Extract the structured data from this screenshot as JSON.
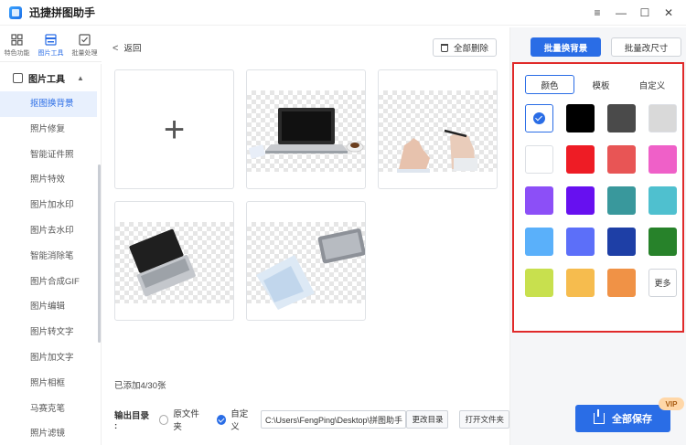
{
  "app": {
    "title": "迅捷拼图助手"
  },
  "window_controls": {
    "menu": "≡",
    "minimize": "—",
    "maximize": "☐",
    "close": "✕"
  },
  "top_icons": [
    {
      "label": "特色功能",
      "icon": "grid-icon"
    },
    {
      "label": "图片工具",
      "icon": "image-tool-icon",
      "active": true
    },
    {
      "label": "批量处理",
      "icon": "batch-icon"
    }
  ],
  "sidebar": {
    "header": "图片工具",
    "items": [
      "抠图换背景",
      "照片修复",
      "智能证件照",
      "照片特效",
      "图片加水印",
      "图片去水印",
      "智能消除笔",
      "图片合成GIF",
      "图片编辑",
      "图片转文字",
      "图片加文字",
      "照片相框",
      "马赛克笔",
      "照片滤镜"
    ],
    "active_index": 0
  },
  "main": {
    "back_label": "返回",
    "delete_all_label": "全部删除",
    "count_text": "已添加4/30张",
    "output": {
      "label": "输出目录 :",
      "option_original": "原文件夹",
      "option_custom": "自定义",
      "path_value": "C:\\Users\\FengPing\\Desktop\\拼图助手",
      "change_button": "更改目录",
      "open_button": "打开文件夹"
    }
  },
  "right_panel": {
    "tabs": [
      "批量换背景",
      "批量改尺寸"
    ],
    "color_tabs": [
      "颜色",
      "模板",
      "自定义"
    ],
    "swatches": [
      "#ffffff",
      "#000000",
      "#4a4a4a",
      "#d9d9d9",
      "#ffffff",
      "#ee1c25",
      "#e85555",
      "#ef60c8",
      "#8c4ff7",
      "#6710f0",
      "#39989c",
      "#4fc0cf",
      "#5ab0fa",
      "#5c6ff9",
      "#1e3fa6",
      "#27822a",
      "#c8e04e",
      "#f6bc4e",
      "#f09246"
    ],
    "more_label": "更多",
    "save_label": "全部保存",
    "vip_label": "VIP"
  }
}
